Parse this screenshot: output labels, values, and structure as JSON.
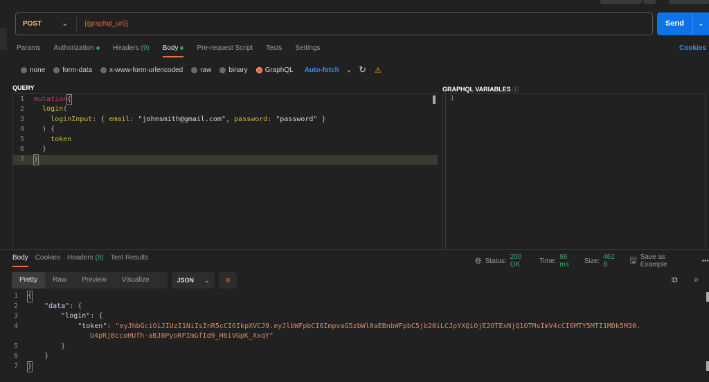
{
  "request": {
    "method": "POST",
    "url": "{{graphql_url}}",
    "send_label": "Send"
  },
  "tabs": [
    {
      "label": "Params"
    },
    {
      "label": "Authorization",
      "dot": true
    },
    {
      "label": "Headers",
      "count": "(9)"
    },
    {
      "label": "Body",
      "dot": true,
      "active": true
    },
    {
      "label": "Pre-request Script"
    },
    {
      "label": "Tests"
    },
    {
      "label": "Settings"
    }
  ],
  "cookies_link": "Cookies",
  "body_types": [
    {
      "label": "none"
    },
    {
      "label": "form-data"
    },
    {
      "label": "x-www-form-urlencoded"
    },
    {
      "label": "raw"
    },
    {
      "label": "binary"
    },
    {
      "label": "GraphQL",
      "selected": true
    }
  ],
  "auto_fetch": "Auto-fetch",
  "query": {
    "label": "QUERY",
    "lines": [
      "1",
      "2",
      "3",
      "4",
      "5",
      "6",
      "7"
    ]
  },
  "variables": {
    "label": "GRAPHQL VARIABLES",
    "lines": [
      "1"
    ]
  },
  "response": {
    "tabs": [
      {
        "label": "Body",
        "active": true
      },
      {
        "label": "Cookies"
      },
      {
        "label": "Headers",
        "count": "(8)"
      },
      {
        "label": "Test Results"
      }
    ],
    "status_label": "Status:",
    "status": "200 OK",
    "time_label": "Time:",
    "time": "96 ms",
    "size_label": "Size:",
    "size": "461 B",
    "save_example": "Save as Example",
    "views": [
      "Pretty",
      "Raw",
      "Preview",
      "Visualize"
    ],
    "format": "JSON",
    "lines": [
      "1",
      "2",
      "3",
      "4",
      "",
      "5",
      "6",
      "7"
    ],
    "token_part1": "\"eyJhbGciOiJIUzI1NiIsInR5cCI6IkpXVCJ9.eyJlbWFpbCI6ImpvaG5zbWl0aEBnbWFpbC5jb20iLCJpYXQiOjE2OTExNjQ1OTMsImV4cCI6MTY5MTI1MDk5M30.",
    "token_part2": "U4pRjBccoHUfh-aBJ8PyoRFImGfId9_H6iVGpK_XxqY\""
  },
  "colors": {
    "accent": "#f26b3a",
    "send": "#0e73e6",
    "status_ok": "#3ea66b",
    "link": "#3b8cf0"
  }
}
